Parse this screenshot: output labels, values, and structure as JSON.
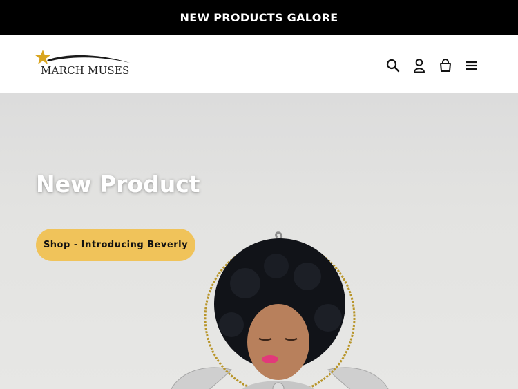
{
  "announcement": {
    "text": "NEW PRODUCTS GALORE"
  },
  "header": {
    "logo_text": "MARCH MUSES",
    "icons": [
      "search-icon",
      "account-icon",
      "cart-icon",
      "menu-icon"
    ]
  },
  "hero": {
    "title": "New Product",
    "button_label": "Shop - Introducing Beverly"
  },
  "colors": {
    "announcement_bg": "#000000",
    "button_bg": "#f0c35a",
    "star": "#d9a520"
  }
}
